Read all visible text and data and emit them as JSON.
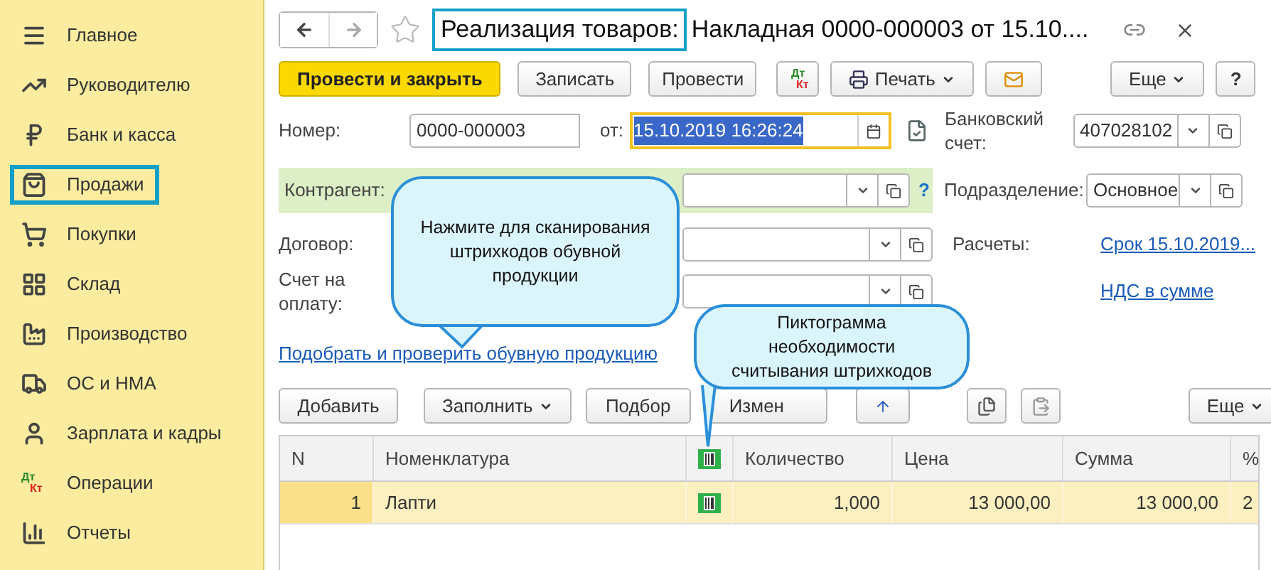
{
  "sidebar": {
    "items": [
      {
        "label": "Главное",
        "highlighted": false
      },
      {
        "label": "Руководителю",
        "highlighted": false
      },
      {
        "label": "Банк и касса",
        "highlighted": false
      },
      {
        "label": "Продажи",
        "highlighted": true
      },
      {
        "label": "Покупки",
        "highlighted": false
      },
      {
        "label": "Склад",
        "highlighted": false
      },
      {
        "label": "Производство",
        "highlighted": false
      },
      {
        "label": "ОС и НМА",
        "highlighted": false
      },
      {
        "label": "Зарплата и кадры",
        "highlighted": false
      },
      {
        "label": "Операции",
        "highlighted": false,
        "icon_text": [
          "Дт",
          "Кт"
        ]
      },
      {
        "label": "Отчеты",
        "highlighted": false
      }
    ]
  },
  "document": {
    "title_highlighted": "Реализация товаров:",
    "title_rest": "Накладная 0000-000003 от 15.10....",
    "toolbar": {
      "primary": "Провести и закрыть",
      "write": "Записать",
      "post": "Провести",
      "dtkt": [
        "Дт",
        "Кт"
      ],
      "print": "Печать",
      "more": "Еще",
      "help": "?"
    },
    "number": {
      "label": "Номер:",
      "value": "0000-000003"
    },
    "date": {
      "label": "от:",
      "value": "15.10.2019 16:26:24"
    },
    "bank_account": {
      "label": "Банковский счет:",
      "value": "407028102"
    },
    "counterparty": {
      "label": "Контрагент:",
      "help": "?"
    },
    "department": {
      "label": "Подразделение:",
      "value": "Основное"
    },
    "contract": {
      "label": "Договор:"
    },
    "settlements": {
      "label": "Расчеты:",
      "link": "Срок 15.10.2019..."
    },
    "invoice": {
      "label": "Счет на оплату:"
    },
    "vat_link": "НДС в сумме",
    "shoe_link": "Подобрать и проверить обувную продукцию"
  },
  "table_toolbar": {
    "add": "Добавить",
    "fill": "Заполнить",
    "pick": "Подбор",
    "change": "Измен",
    "more": "Еще"
  },
  "table": {
    "columns": [
      "N",
      "Номенклатура",
      "",
      "Количество",
      "Цена",
      "Сумма",
      "%"
    ],
    "rows": [
      {
        "cells": [
          "1",
          "Лапти",
          "",
          "1,000",
          "13 000,00",
          "13 000,00",
          "2"
        ],
        "selected": true
      }
    ]
  },
  "callouts": [
    {
      "text": "Нажмите для сканирования штрихкодов обувной продукции"
    },
    {
      "text": "Пиктограмма необходимости считывания штрихкодов"
    }
  ]
}
